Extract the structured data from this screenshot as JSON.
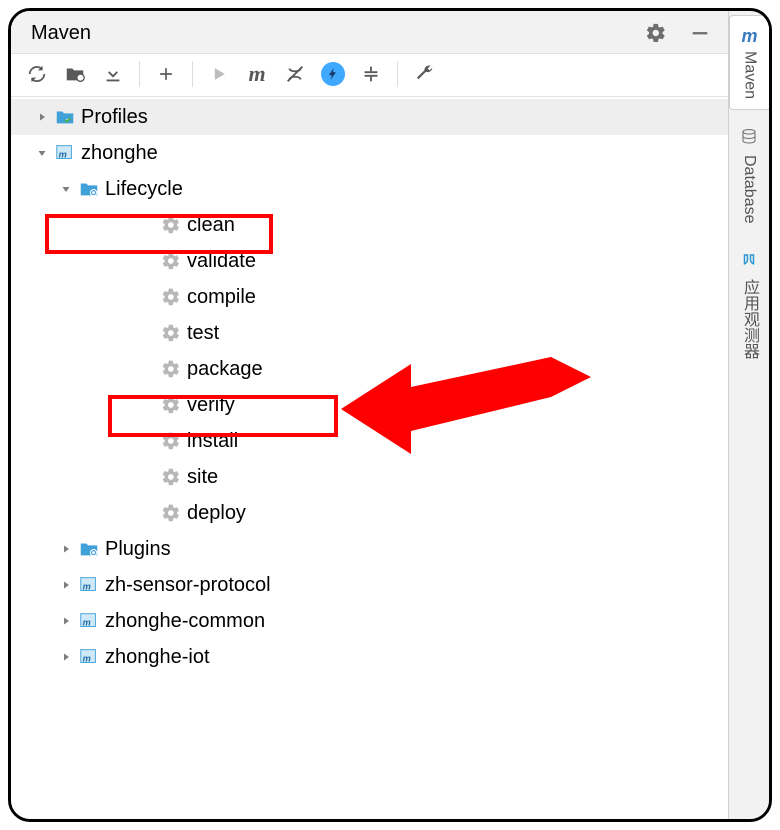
{
  "panel": {
    "title": "Maven"
  },
  "tree": {
    "root1": {
      "label": "Profiles"
    },
    "root2": {
      "label": "zhonghe",
      "lifecycle": {
        "label": "Lifecycle",
        "goals": [
          "clean",
          "validate",
          "compile",
          "test",
          "package",
          "verify",
          "install",
          "site",
          "deploy"
        ]
      },
      "plugins": {
        "label": "Plugins"
      },
      "modules": [
        {
          "label": "zh-sensor-protocol"
        },
        {
          "label": "zhonghe-common"
        },
        {
          "label": "zhonghe-iot"
        }
      ]
    }
  },
  "sidebar": {
    "items": [
      {
        "label": "Maven"
      },
      {
        "label": "Database"
      },
      {
        "label": "应用观测器"
      }
    ]
  }
}
